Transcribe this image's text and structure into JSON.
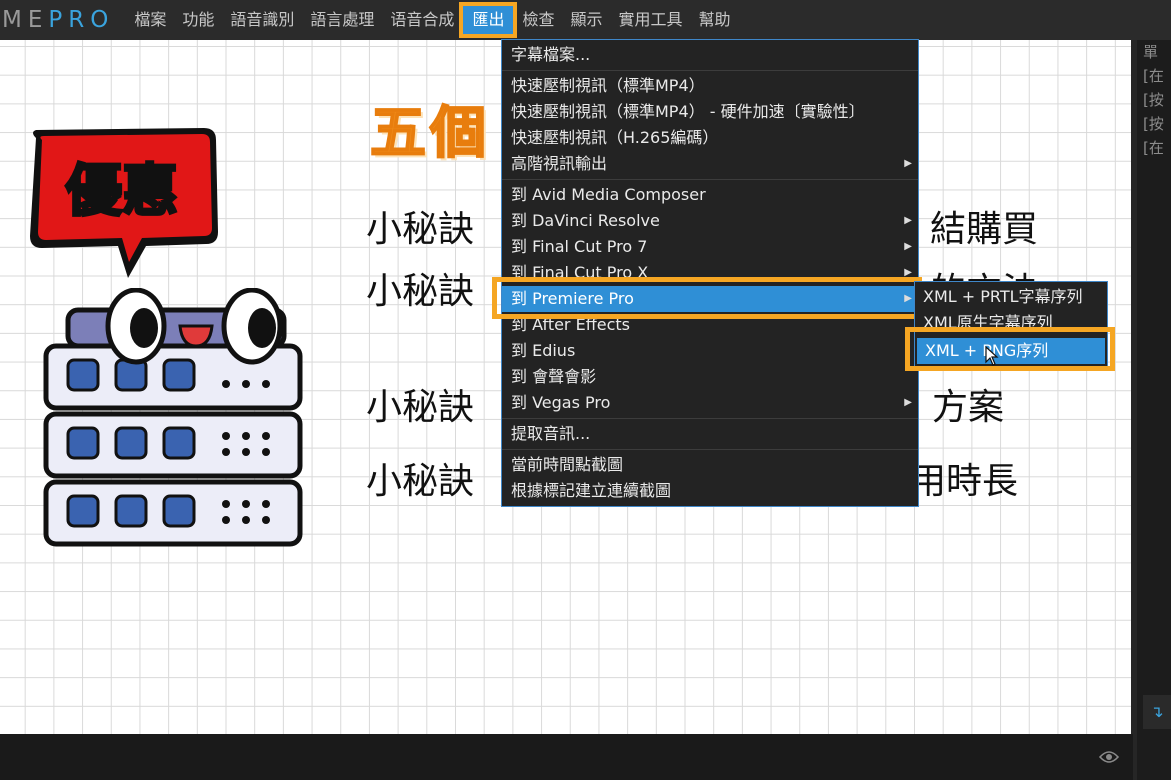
{
  "app": {
    "logo_me": "ME",
    "logo_pro": "PRO"
  },
  "menubar": {
    "items": [
      "檔案",
      "功能",
      "語音識別",
      "語言處理",
      "语音合成",
      "匯出",
      "檢查",
      "顯示",
      "實用工具",
      "幫助"
    ],
    "active_index": 5
  },
  "slide": {
    "bubble_text": "優惠",
    "title": "五個",
    "tips": [
      {
        "left": "小秘訣",
        "right": "結購買"
      },
      {
        "left": "小秘訣",
        "right": "的方法"
      },
      {
        "left": "小秘訣",
        "right": "方案"
      },
      {
        "left": "小秘訣",
        "right": "用時長"
      }
    ]
  },
  "export_menu": {
    "items": [
      {
        "label": "字幕檔案...",
        "submenu": false
      },
      {
        "separator": true
      },
      {
        "label": "快速壓制視訊（標準MP4）",
        "submenu": false
      },
      {
        "label": "快速壓制視訊（標準MP4） - 硬件加速〔實驗性〕",
        "submenu": false
      },
      {
        "label": "快速壓制視訊（H.265編碼）",
        "submenu": false
      },
      {
        "label": "高階視訊輸出",
        "submenu": true
      },
      {
        "separator": true
      },
      {
        "label": "到 Avid Media Composer",
        "submenu": false
      },
      {
        "label": "到 DaVinci Resolve",
        "submenu": true
      },
      {
        "label": "到 Final Cut Pro 7",
        "submenu": true
      },
      {
        "label": "到 Final Cut Pro X",
        "submenu": true
      },
      {
        "label": "到 Premiere Pro",
        "submenu": true,
        "highlighted": true
      },
      {
        "label": "到 After Effects",
        "submenu": false
      },
      {
        "label": "到 Edius",
        "submenu": false
      },
      {
        "label": "到 會聲會影",
        "submenu": false
      },
      {
        "label": "到 Vegas Pro",
        "submenu": true
      },
      {
        "separator": true
      },
      {
        "label": "提取音訊...",
        "submenu": false
      },
      {
        "separator": true
      },
      {
        "label": "當前時間點截圖",
        "submenu": false
      },
      {
        "label": "根據標記建立連續截圖",
        "submenu": false
      }
    ]
  },
  "premiere_submenu": {
    "items": [
      {
        "label": "XML + PRTL字幕序列"
      },
      {
        "label": "XML原生字幕序列"
      },
      {
        "label": "XML + PNG序列",
        "highlighted": true
      }
    ]
  },
  "right_panel": {
    "lines": [
      "單",
      "[在",
      "[按",
      "[按",
      "[在"
    ],
    "arrow": "↴"
  },
  "colors": {
    "accent": "#2f8fd6",
    "highlight_box": "#f5a623",
    "brand_blue": "#3aa3dd"
  }
}
